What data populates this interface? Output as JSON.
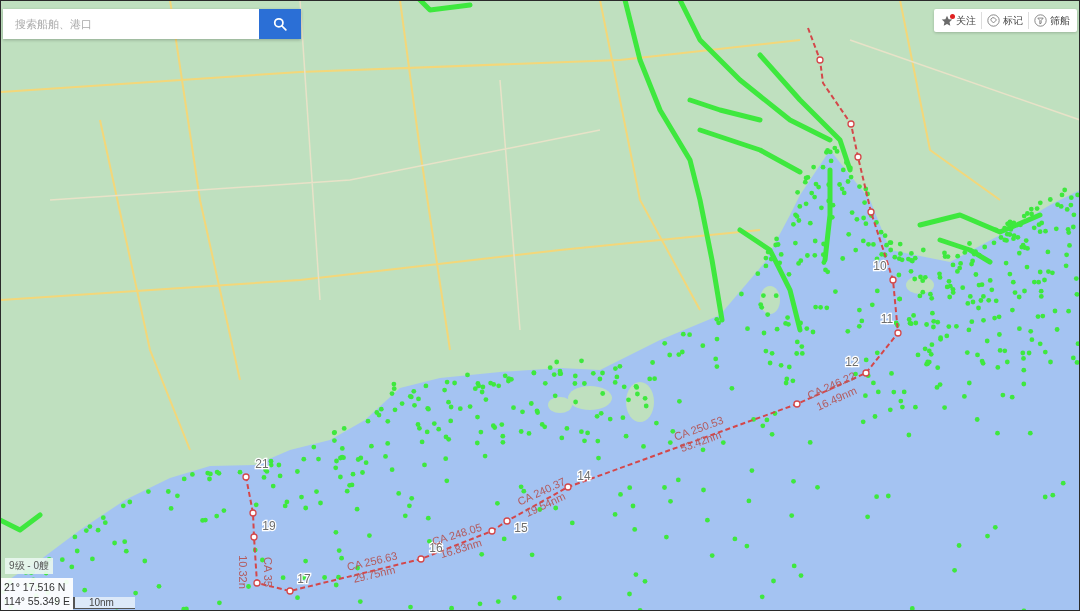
{
  "search": {
    "placeholder": "搜索船舶、港口"
  },
  "toolbar": [
    {
      "kind": "follow",
      "label": "关注",
      "notification_dot": true
    },
    {
      "kind": "mark",
      "label": "标记",
      "notification_dot": false
    },
    {
      "kind": "filter",
      "label": "筛船",
      "notification_dot": false
    }
  ],
  "route": {
    "waypoints": [
      {
        "label": "10"
      },
      {
        "label": "11"
      },
      {
        "label": "12"
      },
      {
        "label": "14"
      },
      {
        "label": "15"
      },
      {
        "label": "16"
      },
      {
        "label": "17"
      },
      {
        "label": "19"
      },
      {
        "label": "21"
      }
    ],
    "legs": [
      {
        "course": "CA 246.22",
        "distance": "16.49nm"
      },
      {
        "course": "CA 250.53",
        "distance": "53.42nm"
      },
      {
        "course": "CA 240.37",
        "distance": "19.54nm"
      },
      {
        "course": "CA 248.05",
        "distance": "16.83nm"
      },
      {
        "course": "CA 256.63",
        "distance": "29.75nm"
      },
      {
        "course": "CA 35",
        "distance": "10.32n"
      }
    ]
  },
  "status": {
    "zoom_level": "9级 - 0艘",
    "latitude": "21° 17.516 N",
    "longitude": "114° 55.349 E",
    "scale": "10nm"
  }
}
